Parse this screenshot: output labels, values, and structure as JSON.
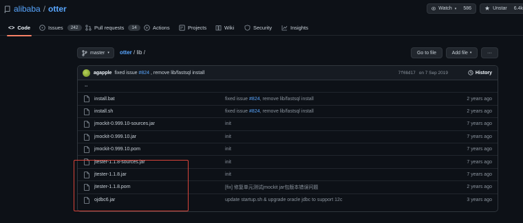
{
  "repo": {
    "owner": "alibaba",
    "separator": "/",
    "name": "otter"
  },
  "header_buttons": {
    "watch_label": "Watch",
    "watch_count": "586",
    "unstar_label": "Unstar",
    "star_count": "6.4k"
  },
  "tabs": [
    {
      "label": "Code",
      "icon": "code-icon"
    },
    {
      "label": "Issues",
      "icon": "issue-icon",
      "count": "242"
    },
    {
      "label": "Pull requests",
      "icon": "pull-request-icon",
      "count": "14"
    },
    {
      "label": "Actions",
      "icon": "play-icon"
    },
    {
      "label": "Projects",
      "icon": "project-icon"
    },
    {
      "label": "Wiki",
      "icon": "book-icon"
    },
    {
      "label": "Security",
      "icon": "shield-icon"
    },
    {
      "label": "Insights",
      "icon": "graph-icon"
    }
  ],
  "toolbar": {
    "branch": "master",
    "path_repo": "otter",
    "path_sep1": "/",
    "path_dir": "lib",
    "path_sep2": "/",
    "goto_file": "Go to file",
    "add_file": "Add file",
    "more": "···"
  },
  "commit": {
    "author": "agapple",
    "message_prefix": "fixed issue",
    "issue_link": "#824",
    "message_suffix": ", remove lib/fastsql install",
    "sha": "7f08d17",
    "date": "on 7 Sep 2019",
    "history_label": "History"
  },
  "parent_dir": "..",
  "files": [
    {
      "name": "install.bat",
      "msg_prefix": "fixed issue ",
      "msg_link": "#824",
      "msg_suffix": ", remove lib/fastsql install",
      "age": "2 years ago"
    },
    {
      "name": "install.sh",
      "msg_prefix": "fixed issue ",
      "msg_link": "#824",
      "msg_suffix": ", remove lib/fastsql install",
      "age": "2 years ago"
    },
    {
      "name": "jmockit-0.999.10-sources.jar",
      "msg_prefix": "init",
      "msg_link": "",
      "msg_suffix": "",
      "age": "7 years ago"
    },
    {
      "name": "jmockit-0.999.10.jar",
      "msg_prefix": "init",
      "msg_link": "",
      "msg_suffix": "",
      "age": "7 years ago"
    },
    {
      "name": "jmockit-0.999.10.pom",
      "msg_prefix": "init",
      "msg_link": "",
      "msg_suffix": "",
      "age": "7 years ago"
    },
    {
      "name": "jtester-1.1.8-sources.jar",
      "msg_prefix": "init",
      "msg_link": "",
      "msg_suffix": "",
      "age": "7 years ago"
    },
    {
      "name": "jtester-1.1.8.jar",
      "msg_prefix": "init",
      "msg_link": "",
      "msg_suffix": "",
      "age": "7 years ago"
    },
    {
      "name": "jtester-1.1.8.pom",
      "msg_prefix": "[fix] 修复单元测试jmockit jar包版本错误问题",
      "msg_link": "",
      "msg_suffix": "",
      "age": "2 years ago"
    },
    {
      "name": "ojdbc6.jar",
      "msg_prefix": "update startup.sh & upgrade oracle jdbc to support 12c",
      "msg_link": "",
      "msg_suffix": "",
      "age": "3 years ago"
    }
  ],
  "colors": {
    "background": "#0d1117",
    "link": "#58a6ff",
    "active_tab_underline": "#f78166",
    "highlight_box": "#d9443a"
  }
}
